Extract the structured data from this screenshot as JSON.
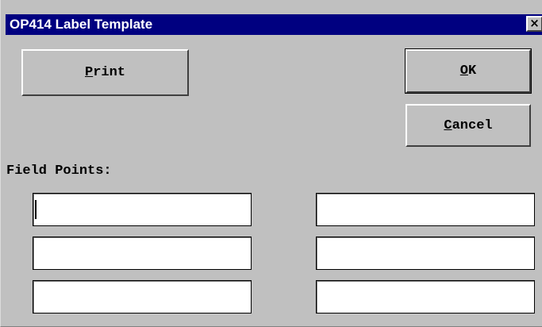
{
  "window": {
    "title": "OP414 Label Template",
    "close_label": "×"
  },
  "buttons": {
    "print": {
      "mnemonic": "P",
      "rest": "rint"
    },
    "ok": {
      "mnemonic": "O",
      "rest": "K"
    },
    "cancel": {
      "mnemonic": "C",
      "rest": "ancel"
    }
  },
  "field_points": {
    "label": "Field Points:",
    "fields": [
      {
        "value": "",
        "focused": true
      },
      {
        "value": ""
      },
      {
        "value": ""
      },
      {
        "value": ""
      },
      {
        "value": ""
      },
      {
        "value": ""
      }
    ]
  },
  "colors": {
    "titlebar": "#000080",
    "face": "#c0c0c0"
  }
}
